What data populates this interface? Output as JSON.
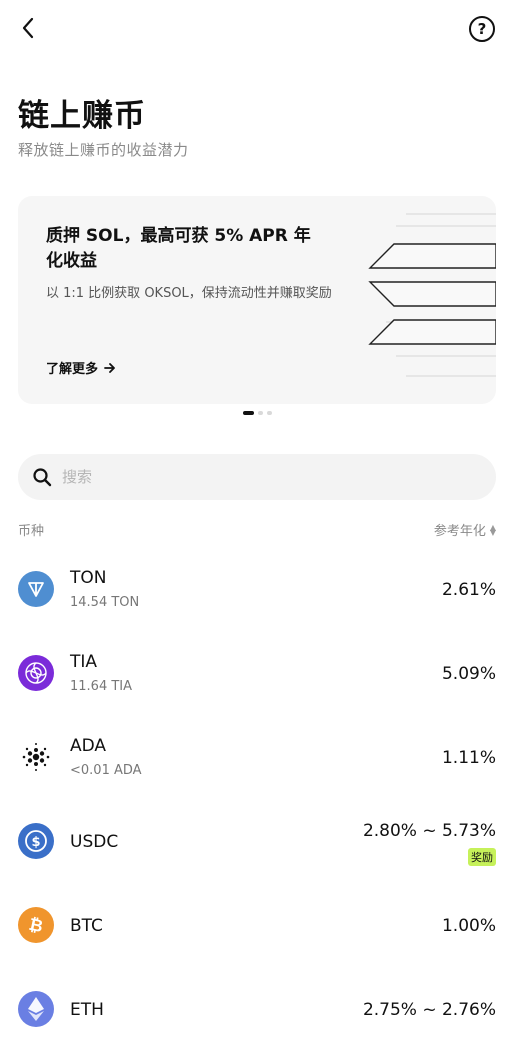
{
  "header": {
    "back_icon": "chevron-left-icon",
    "help_icon": "question-circle-icon",
    "help_glyph": "?"
  },
  "page": {
    "title": "链上赚币",
    "subtitle": "释放链上赚币的收益潜力"
  },
  "banner": {
    "title": "质押 SOL，最高可获 5% APR 年化收益",
    "description": "以 1:1 比例获取 OKSOL，保持流动性并赚取奖励",
    "link_label": "了解更多",
    "link_icon": "arrow-right-icon"
  },
  "carousel": {
    "pages": 3,
    "active": 0
  },
  "search": {
    "placeholder": "搜索",
    "value": ""
  },
  "list_header": {
    "left": "币种",
    "right": "参考年化"
  },
  "coins": [
    {
      "symbol": "TON",
      "holding": "14.54 TON",
      "apr": "2.61%",
      "icon": "ton-icon",
      "color": "#4e8dd0"
    },
    {
      "symbol": "TIA",
      "holding": "11.64 TIA",
      "apr": "5.09%",
      "icon": "tia-icon",
      "color": "#7b2bd9"
    },
    {
      "symbol": "ADA",
      "holding": "<0.01 ADA",
      "apr": "1.11%",
      "icon": "ada-icon",
      "color": "#111111"
    },
    {
      "symbol": "USDC",
      "holding": "",
      "apr": "2.80% ~ 5.73%",
      "badge": "奖励",
      "icon": "usdc-icon",
      "color": "#3a6fc8"
    },
    {
      "symbol": "BTC",
      "holding": "",
      "apr": "1.00%",
      "icon": "btc-icon",
      "color": "#f0952d"
    },
    {
      "symbol": "ETH",
      "holding": "",
      "apr": "2.75% ~ 2.76%",
      "icon": "eth-icon",
      "color": "#6a7fe3"
    }
  ]
}
